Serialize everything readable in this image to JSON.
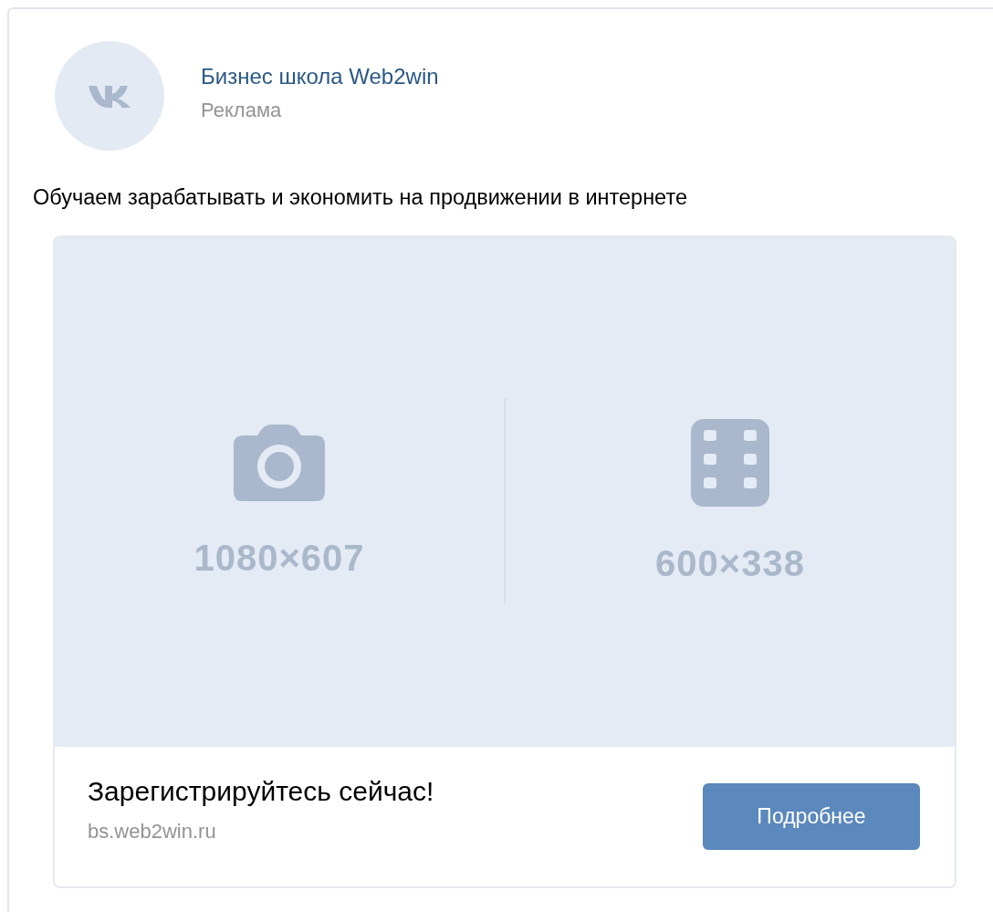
{
  "post": {
    "author": "Бизнес школа Web2win",
    "label": "Реклама",
    "text": "Обучаем зарабатывать и экономить на продвижении в интернете"
  },
  "media": {
    "slots": [
      {
        "kind": "photo",
        "size": "1080×607"
      },
      {
        "kind": "video",
        "size": "600×338"
      }
    ]
  },
  "footer": {
    "title": "Зарегистрируйтесь сейчас!",
    "domain": "bs.web2win.ru",
    "button": "Подробнее"
  }
}
